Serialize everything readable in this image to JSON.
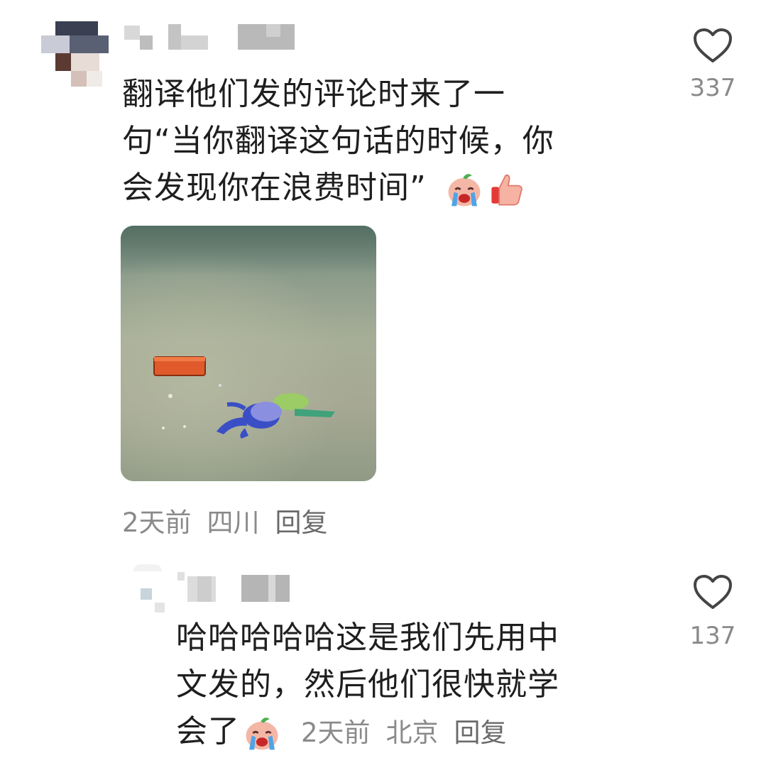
{
  "comments": [
    {
      "text_lines": [
        "翻译他们发的评论时来了一",
        "句“当你翻译这句话的时候，你",
        "会发现你在浪费时间”"
      ],
      "inline_emojis": [
        "crying-face-emoji",
        "thumbs-up-emoji"
      ],
      "meta": {
        "time": "2天前",
        "location": "四川",
        "reply": "回复"
      },
      "likes": "337"
    },
    {
      "text_lines": [
        "哈哈哈哈哈这是我们先用中",
        "文发的，然后他们很快就学",
        "会了"
      ],
      "inline_emojis": [
        "crying-face-emoji"
      ],
      "meta": {
        "time": "2天前",
        "location": "北京",
        "reply": "回复"
      },
      "likes": "137"
    }
  ],
  "icons": {
    "like": "heart-outline-icon"
  },
  "colors": {
    "text": "#1e1e1e",
    "meta": "#8a8a8a",
    "heart_stroke": "#444444"
  }
}
